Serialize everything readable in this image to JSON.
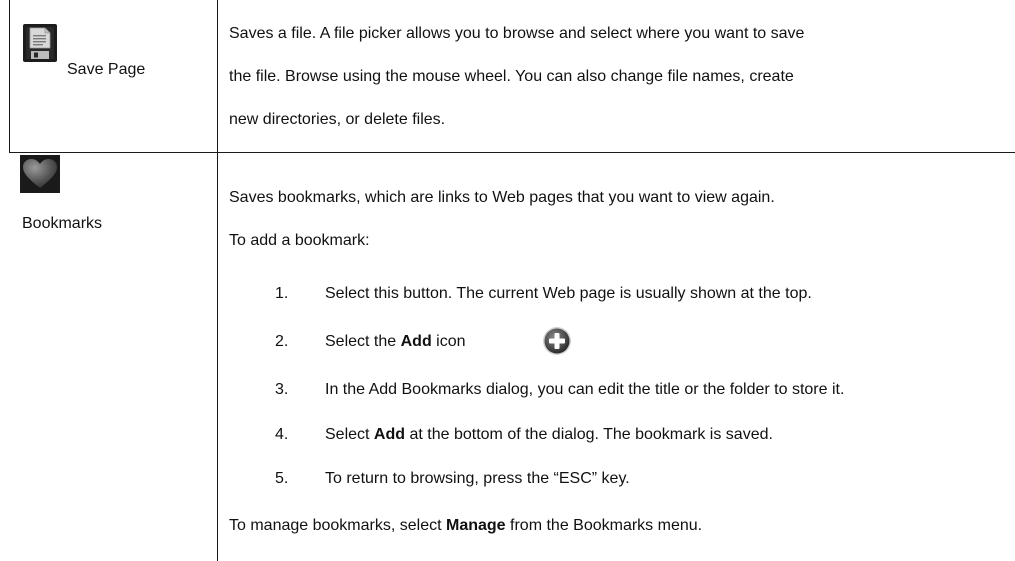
{
  "rows": [
    {
      "name": "Save Page",
      "icon": "floppy-disk-icon",
      "description_lines": [
        "Saves a file. A file picker allows you to browse and select where you want to save",
        "the file. Browse using the mouse wheel. You can also change file names, create",
        "new directories, or delete files."
      ]
    },
    {
      "name": "Bookmarks",
      "icon": "heart-icon",
      "intro": "Saves bookmarks, which are links to Web pages that you want to view again.",
      "add_heading": "To add a bookmark:",
      "steps": [
        {
          "num": "1.",
          "text": "Select this button. The current Web page is usually shown at the top."
        },
        {
          "num": "2.",
          "before": "Select the ",
          "bold": "Add",
          "after": " icon",
          "icon": "add-plus-icon"
        },
        {
          "num": "3.",
          "text": "In the Add Bookmarks dialog, you can edit the title or the folder to store it."
        },
        {
          "num": "4.",
          "before": "Select ",
          "bold": "Add",
          "after": " at the bottom of the dialog. The bookmark is saved."
        },
        {
          "num": "5.",
          "text": "To return to browsing, press the “ESC” key."
        }
      ],
      "manage": {
        "before": "To manage bookmarks, select ",
        "bold": "Manage",
        "after": " from the Bookmarks menu."
      }
    }
  ],
  "colors": {
    "icon_dark": "#1c1c1c",
    "icon_light": "#d8d8d8",
    "line": "#1a1a1a"
  }
}
